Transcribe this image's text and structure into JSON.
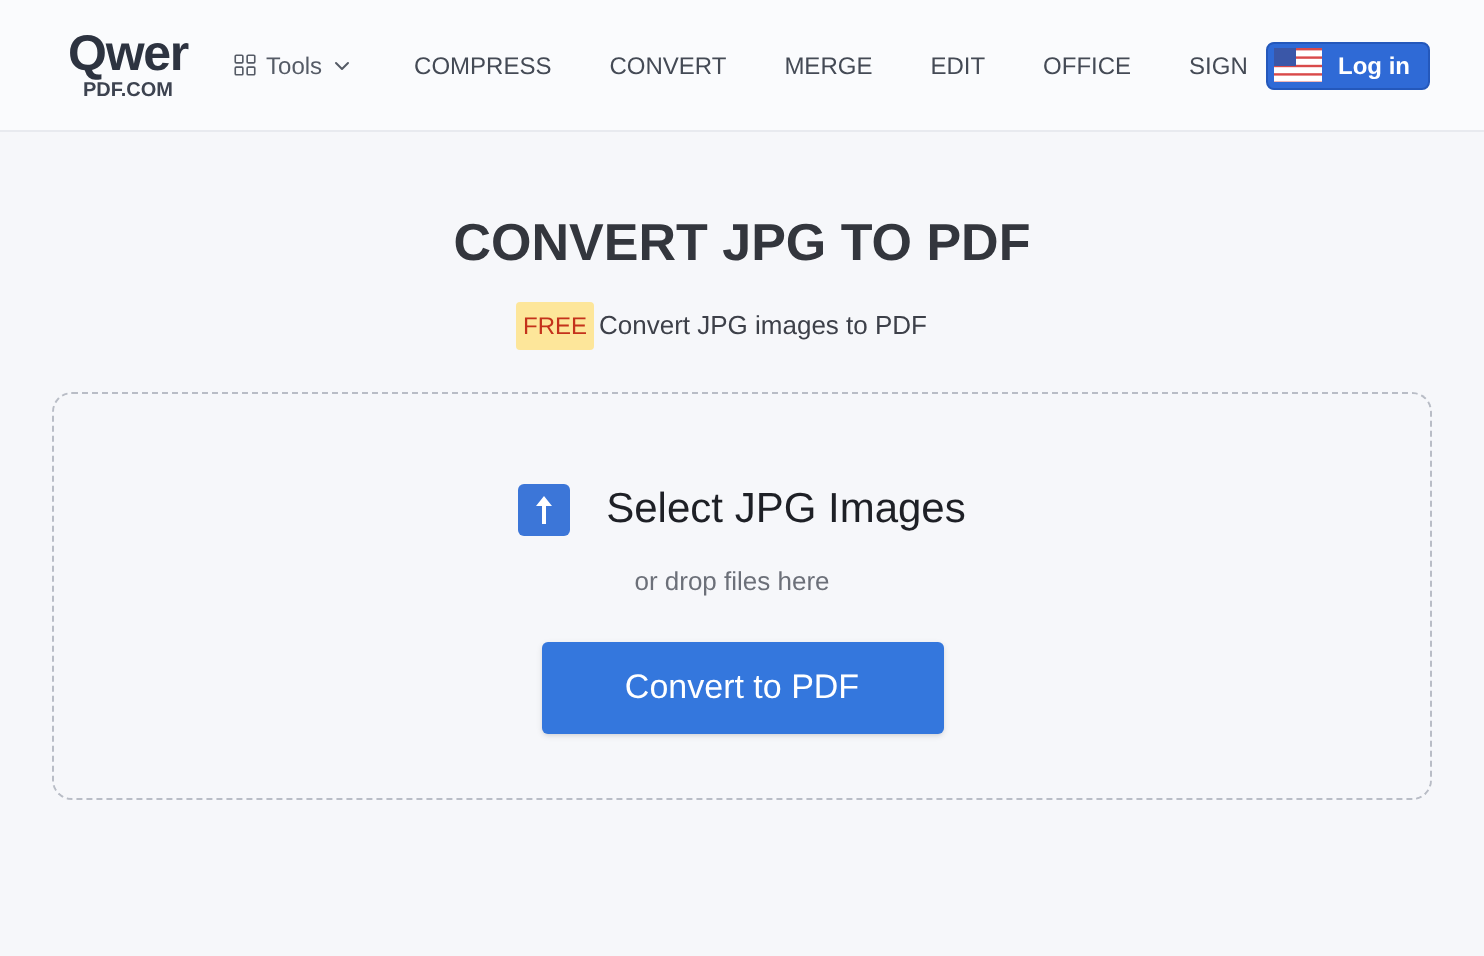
{
  "logo": {
    "top": "Qwer",
    "bottom": "PDF.COM"
  },
  "nav": {
    "tools": "Tools",
    "items": [
      {
        "label": "COMPRESS"
      },
      {
        "label": "CONVERT"
      },
      {
        "label": "MERGE"
      },
      {
        "label": "EDIT"
      },
      {
        "label": "OFFICE"
      },
      {
        "label": "SIGN"
      }
    ],
    "login": "Log in"
  },
  "title": "CONVERT JPG TO PDF",
  "subtitle": {
    "badge": "FREE",
    "text": "Convert JPG images to PDF"
  },
  "upload": {
    "heading": "Select JPG Images",
    "hint": "or drop files here",
    "button": "Convert to PDF"
  }
}
